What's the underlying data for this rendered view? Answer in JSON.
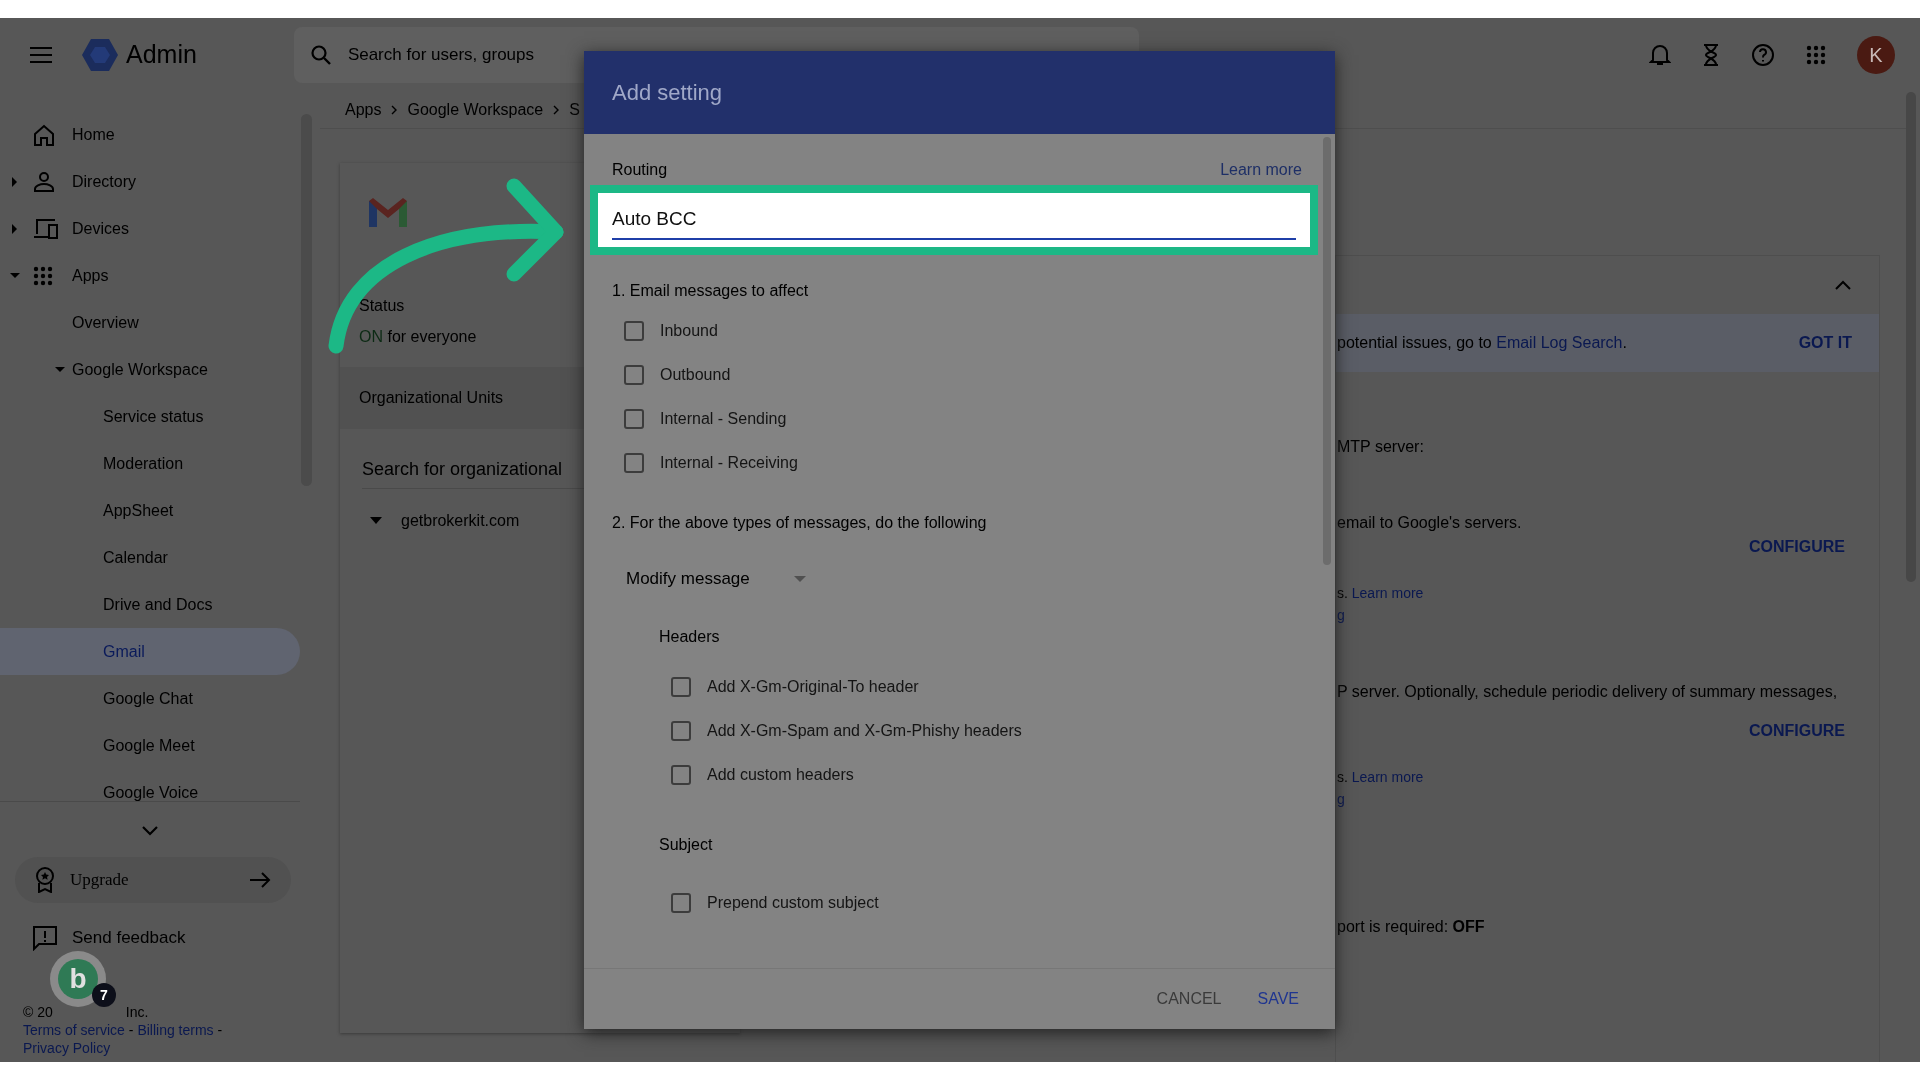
{
  "top_bar": {
    "product": "Admin",
    "search_placeholder": "Search for users, groups",
    "avatar_letter": "K"
  },
  "sidebar": {
    "items": [
      {
        "label": "Home",
        "selected": false
      },
      {
        "label": "Directory",
        "selected": false,
        "expanded": false
      },
      {
        "label": "Devices",
        "selected": false,
        "expanded": false
      },
      {
        "label": "Apps",
        "selected": false,
        "expanded": true,
        "children": [
          {
            "label": "Overview",
            "selected": false
          },
          {
            "label": "Google Workspace",
            "selected": false,
            "expanded": true,
            "children": [
              {
                "label": "Service status",
                "selected": false
              },
              {
                "label": "Moderation",
                "selected": false
              },
              {
                "label": "AppSheet",
                "selected": false
              },
              {
                "label": "Calendar",
                "selected": false
              },
              {
                "label": "Drive and Docs",
                "selected": false
              },
              {
                "label": "Gmail",
                "selected": true
              },
              {
                "label": "Google Chat",
                "selected": false
              },
              {
                "label": "Google Meet",
                "selected": false
              },
              {
                "label": "Google Voice",
                "selected": false
              }
            ]
          }
        ]
      }
    ],
    "upgrade": "Upgrade",
    "feedback": "Send feedback",
    "footer": {
      "copyright_start": "© 20",
      "copyright_end": "Inc.",
      "links_line": [
        "Terms of service",
        " - ",
        "Billing terms",
        " -"
      ],
      "privacy": "Privacy Policy"
    }
  },
  "floating_bubble": {
    "letter": "b",
    "count": "7"
  },
  "breadcrumb": [
    "Apps",
    "Google Workspace",
    "S"
  ],
  "app_card": {
    "status_label": "Status",
    "status_value": "ON",
    "status_suffix": "for everyone",
    "org_units_title": "Organizational Units",
    "org_search_placeholder": "Search for organizational",
    "org_root": "getbrokerkit.com"
  },
  "settings_panel": {
    "banner_text": "potential issues, go to ",
    "banner_link": "Email Log Search",
    "banner_end": ".",
    "banner_action": "GOT IT",
    "lines": [
      {
        "kind": "text",
        "text": "MTP server:"
      },
      {
        "kind": "muted",
        "text": "email to Google's servers."
      },
      {
        "kind": "action",
        "text": "CONFIGURE"
      },
      {
        "kind": "link",
        "text": "s. ",
        "link": "Learn more"
      },
      {
        "kind": "linkonly",
        "text": "g"
      },
      {
        "kind": "muted",
        "text": "P server. Optionally, schedule periodic delivery of summary messages,"
      },
      {
        "kind": "action",
        "text": "CONFIGURE"
      },
      {
        "kind": "link",
        "text": "s. ",
        "link": "Learn more"
      },
      {
        "kind": "linkonly",
        "text": "g"
      },
      {
        "kind": "text",
        "text": "port is required: **OFF**"
      }
    ]
  },
  "dialog": {
    "title": "Add setting",
    "field_label": "Routing",
    "learn_more": "Learn more",
    "field_value": "Auto BCC",
    "section_1": "1. Email messages to affect",
    "affect": [
      {
        "label": "Inbound",
        "checked": false
      },
      {
        "label": "Outbound",
        "checked": false
      },
      {
        "label": "Internal - Sending",
        "checked": false
      },
      {
        "label": "Internal - Receiving",
        "checked": false
      }
    ],
    "section_2": "2. For the above types of messages, do the following",
    "action_select": "Modify message",
    "headers_title": "Headers",
    "headers": [
      {
        "label": "Add X-Gm-Original-To header",
        "checked": false
      },
      {
        "label": "Add X-Gm-Spam and X-Gm-Phishy headers",
        "checked": false
      },
      {
        "label": "Add custom headers",
        "checked": false
      }
    ],
    "subject_title": "Subject",
    "subject": [
      {
        "label": "Prepend custom subject",
        "checked": false
      }
    ],
    "buttons": [
      {
        "label": "CANCEL",
        "kind": "secondary"
      },
      {
        "label": "SAVE",
        "kind": "primary"
      }
    ]
  }
}
